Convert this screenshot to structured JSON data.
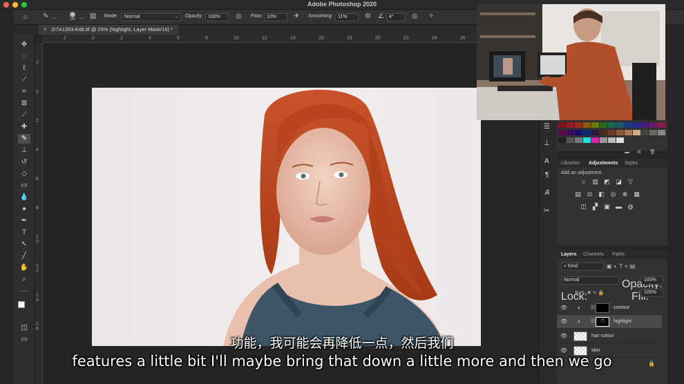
{
  "app": {
    "title": "Adobe Photoshop 2020"
  },
  "options": {
    "brush_size": "100",
    "mode_label": "Mode:",
    "mode_value": "Normal",
    "opacity_label": "Opacity:",
    "opacity_value": "100%",
    "flow_label": "Flow:",
    "flow_value": "10%",
    "smoothing_label": "Smoothing:",
    "smoothing_value": "11%",
    "angle_value": "4°"
  },
  "document": {
    "tab_title": "2I7A1353-Edit.tif @ 25% (highlight, Layer Mask/16) *"
  },
  "rulers": {
    "h_ticks": [
      "2",
      "0",
      "2",
      "4",
      "6",
      "8",
      "10",
      "12",
      "14",
      "16",
      "18",
      "20",
      "22",
      "24",
      "26"
    ],
    "v_ticks": [
      "2",
      "0",
      "2",
      "4",
      "6",
      "8",
      "1 0",
      "1 2",
      "1 4",
      "1 6"
    ]
  },
  "adjustments": {
    "tabs": [
      "Libraries",
      "Adjustments",
      "Styles"
    ],
    "active_tab": "Adjustments",
    "hint": "Add an adjustment"
  },
  "layers_panel": {
    "tabs": [
      "Layers",
      "Channels",
      "Paths"
    ],
    "filter_kind": "Kind",
    "blend_mode": "Normal",
    "opacity_label": "Opacity:",
    "opacity_value": "100%",
    "lock_label": "Lock:",
    "fill_label": "Fill:",
    "fill_value": "100%",
    "layers": [
      {
        "name": "contour",
        "has_mask": true,
        "selected": false
      },
      {
        "name": "highlight",
        "has_mask": true,
        "selected": true
      },
      {
        "name": "hair colour",
        "has_mask": false,
        "selected": false
      },
      {
        "name": "skin",
        "has_mask": false,
        "selected": false
      }
    ]
  },
  "subtitles": {
    "chinese": "功能，我可能会再降低一点，然后我们",
    "english": "features a little bit I'll maybe bring that down a little more and then we go"
  },
  "colors": {
    "hair": "#c4461e",
    "tank_top": "#3d5566",
    "accent": "#4b9ff0"
  }
}
